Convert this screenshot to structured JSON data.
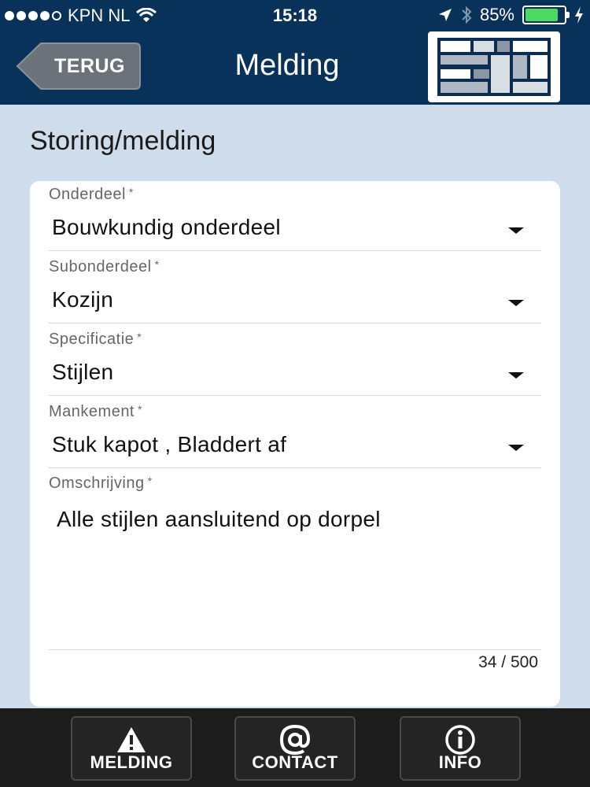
{
  "status_bar": {
    "carrier": "KPN NL",
    "time": "15:18",
    "battery": "85%",
    "battery_level": 0.85
  },
  "header": {
    "back_label": "TERUG",
    "title": "Melding",
    "colors": {
      "bar": "#08325a",
      "back_button": "#6b7279"
    }
  },
  "form": {
    "section_title": "Storing/melding",
    "required_mark": "*",
    "fields": [
      {
        "label": "Onderdeel",
        "value": "Bouwkundig onderdeel"
      },
      {
        "label": "Subonderdeel",
        "value": "Kozijn"
      },
      {
        "label": "Specificatie",
        "value": "Stijlen"
      },
      {
        "label": "Mankement",
        "value": "Stuk kapot , Bladdert af"
      }
    ],
    "description": {
      "label": "Omschrijving",
      "value": "Alle stijlen aansluitend op dorpel",
      "counter": "34 / 500"
    }
  },
  "tabbar": {
    "tabs": [
      {
        "label": "MELDING",
        "icon": "warning-icon"
      },
      {
        "label": "CONTACT",
        "icon": "at-sign-icon"
      },
      {
        "label": "INFO",
        "icon": "info-icon"
      }
    ]
  }
}
